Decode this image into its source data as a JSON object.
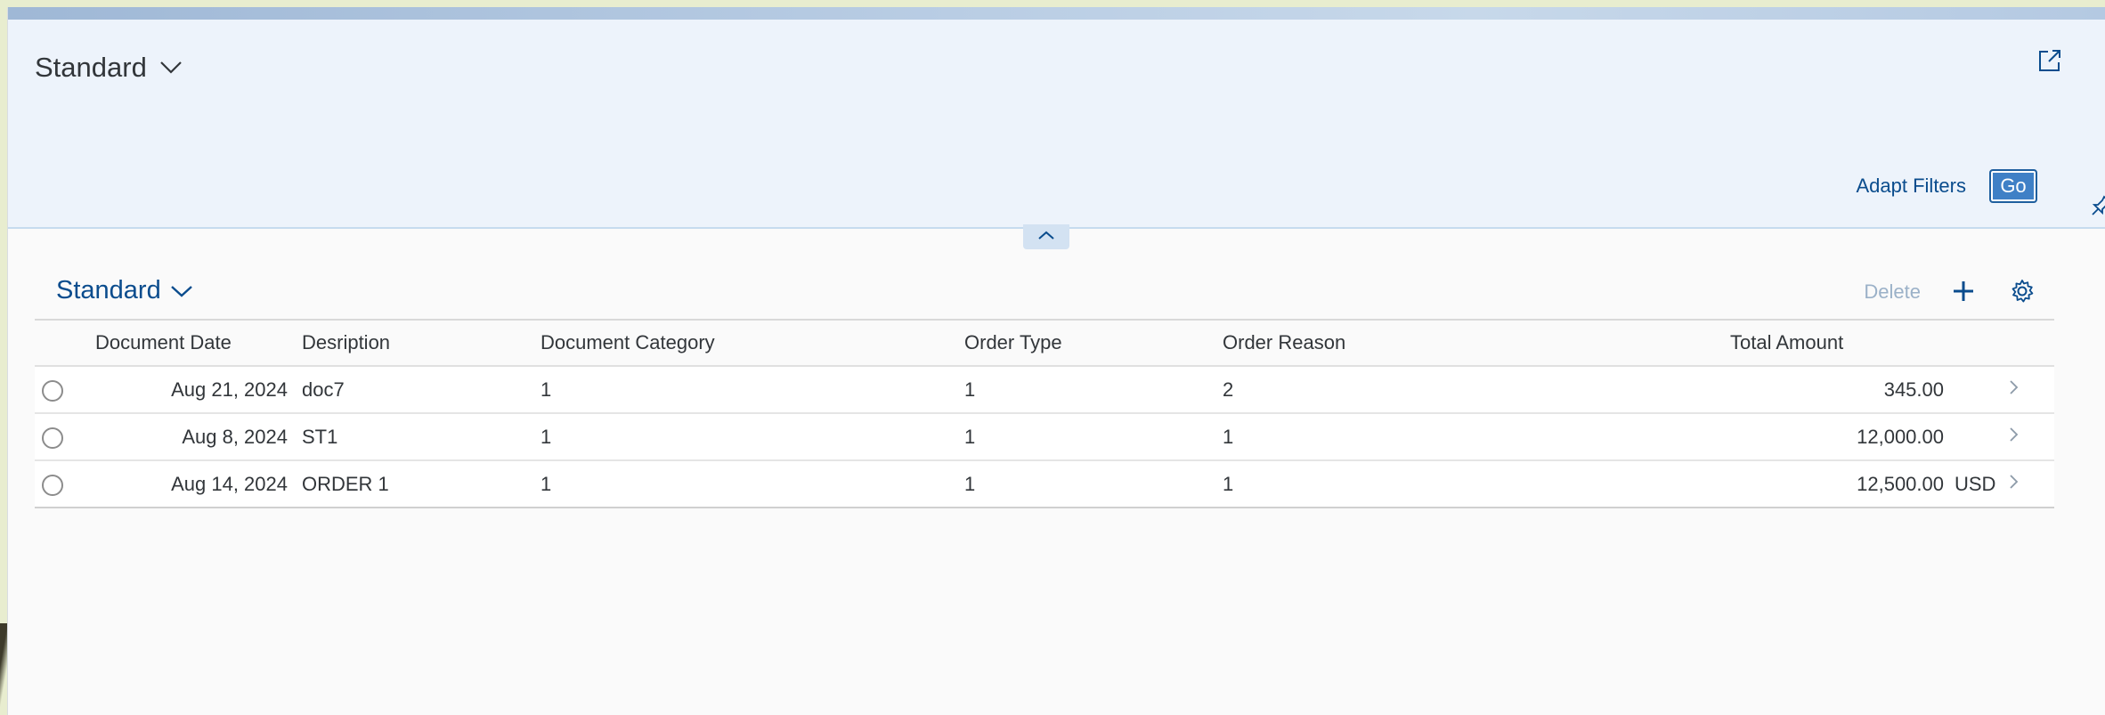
{
  "header": {
    "variant_title": "Standard",
    "adapt_filters_label": "Adapt Filters",
    "go_label": "Go"
  },
  "table": {
    "title": "Standard",
    "delete_label": "Delete",
    "columns": {
      "document_date": "Document Date",
      "description": "Desription",
      "document_category": "Document Category",
      "order_type": "Order Type",
      "order_reason": "Order Reason",
      "total_amount": "Total Amount"
    },
    "rows": [
      {
        "document_date": "Aug 21, 2024",
        "description": "doc7",
        "document_category": "1",
        "order_type": "1",
        "order_reason": "2",
        "total_amount": "345.00",
        "currency": ""
      },
      {
        "document_date": "Aug 8, 2024",
        "description": "ST1",
        "document_category": "1",
        "order_type": "1",
        "order_reason": "1",
        "total_amount": "12,000.00",
        "currency": ""
      },
      {
        "document_date": "Aug 14, 2024",
        "description": "ORDER 1",
        "document_category": "1",
        "order_type": "1",
        "order_reason": "1",
        "total_amount": "12,500.00",
        "currency": "USD"
      }
    ]
  },
  "icons": {
    "variant_chevron": "chevron-down-icon",
    "share": "share-icon",
    "pin": "pin-icon",
    "collapse": "chevron-up-icon",
    "add": "plus-icon",
    "settings": "gear-icon",
    "row_nav": "chevron-right-icon"
  },
  "colors": {
    "brand_blue": "#0a4c8d",
    "go_button": "#3f80c6",
    "header_bg": "#edf3fb"
  }
}
